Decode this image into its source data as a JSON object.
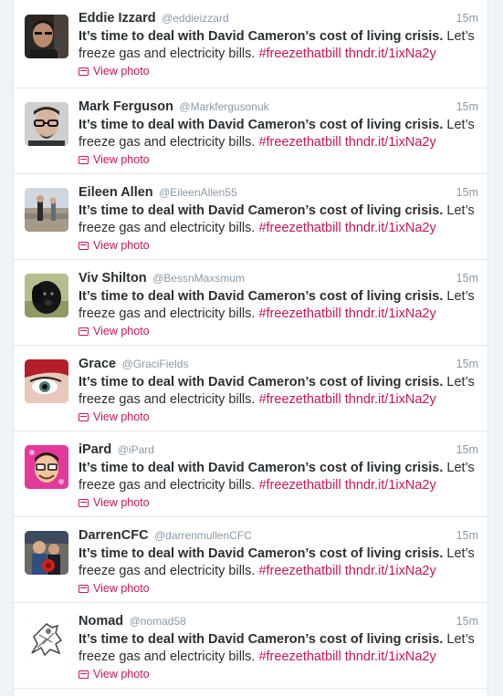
{
  "tweets": [
    {
      "name": "Eddie Izzard",
      "handle": "@eddieizzard",
      "time": "15m",
      "text_bold": "It’s time to deal with David Cameron’s cost of living crisis.",
      "text_rest": " Let’s freeze gas and electricity bills. ",
      "hashtag": "#freezethatbill",
      "link": "thndr.it/1ixNa2y",
      "photo_label": "View photo",
      "avatar": "eddie-avatar"
    },
    {
      "name": "Mark Ferguson",
      "handle": "@Markfergusonuk",
      "time": "15m",
      "text_bold": "It’s time to deal with David Cameron’s cost of living crisis.",
      "text_rest": " Let’s freeze gas and electricity bills. ",
      "hashtag": "#freezethatbill",
      "link": "thndr.it/1ixNa2y",
      "photo_label": "View photo",
      "avatar": "mark-avatar"
    },
    {
      "name": "Eileen Allen",
      "handle": "@EileenAllen55",
      "time": "15m",
      "text_bold": "It’s time to deal with David Cameron’s cost of living crisis.",
      "text_rest": " Let’s freeze gas and electricity bills. ",
      "hashtag": "#freezethatbill",
      "link": "thndr.it/1ixNa2y",
      "photo_label": "View photo",
      "avatar": "eileen-avatar"
    },
    {
      "name": "Viv Shilton",
      "handle": "@BessnMaxsmum",
      "time": "15m",
      "text_bold": "It’s time to deal with David Cameron’s cost of living crisis.",
      "text_rest": " Let’s freeze gas and electricity bills. ",
      "hashtag": "#freezethatbill",
      "link": "thndr.it/1ixNa2y",
      "photo_label": "View photo",
      "avatar": "viv-avatar"
    },
    {
      "name": "Grace",
      "handle": "@GraciFields",
      "time": "15m",
      "text_bold": "It’s time to deal with David Cameron’s cost of living crisis.",
      "text_rest": " Let’s freeze gas and electricity bills. ",
      "hashtag": "#freezethatbill",
      "link": "thndr.it/1ixNa2y",
      "photo_label": "View photo",
      "avatar": "grace-avatar"
    },
    {
      "name": "iPard",
      "handle": "@iPard",
      "time": "15m",
      "text_bold": "It’s time to deal with David Cameron’s cost of living crisis.",
      "text_rest": " Let’s freeze gas and electricity bills. ",
      "hashtag": "#freezethatbill",
      "link": "thndr.it/1ixNa2y",
      "photo_label": "View photo",
      "avatar": "ipard-avatar"
    },
    {
      "name": "DarrenCFC",
      "handle": "@darrenmullenCFC",
      "time": "15m",
      "text_bold": "It’s time to deal with David Cameron’s cost of living crisis.",
      "text_rest": " Let’s freeze gas and electricity bills. ",
      "hashtag": "#freezethatbill",
      "link": "thndr.it/1ixNa2y",
      "photo_label": "View photo",
      "avatar": "darren-avatar"
    },
    {
      "name": "Nomad",
      "handle": "@nomad58",
      "time": "15m",
      "text_bold": "It’s time to deal with David Cameron’s cost of living crisis.",
      "text_rest": " Let’s freeze gas and electricity bills. ",
      "hashtag": "#freezethatbill",
      "link": "thndr.it/1ixNa2y",
      "photo_label": "View photo",
      "avatar": "nomad-avatar"
    }
  ],
  "colors": {
    "link": "#c2185b",
    "name": "#292f33",
    "meta": "#8899a6"
  }
}
